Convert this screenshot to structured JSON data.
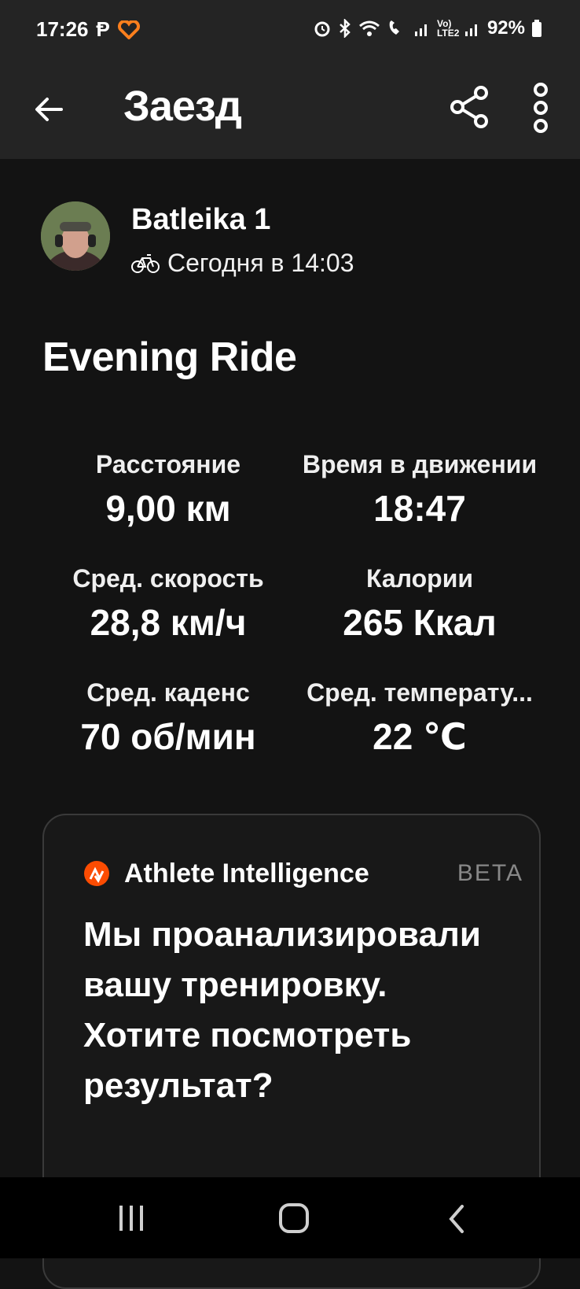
{
  "status_bar": {
    "time": "17:26",
    "battery": "92%",
    "icons": [
      "p-app-icon",
      "strava-heart-icon",
      "alarm-icon",
      "bluetooth-icon",
      "wifi-icon",
      "wifi-call-icon",
      "signal-icon",
      "volte-icon",
      "signal-icon-2",
      "battery-icon"
    ]
  },
  "app_bar": {
    "title": "Заезд",
    "icons": [
      "back-arrow-icon",
      "share-icon",
      "more-vertical-icon"
    ]
  },
  "athlete": {
    "name": "Batleika 1",
    "meta": "Сегодня в 14:03",
    "activity_icon": "bike-icon"
  },
  "activity": {
    "title": "Evening Ride"
  },
  "stats": [
    {
      "label": "Расстояние",
      "value": "9,00 км"
    },
    {
      "label": "Время в движении",
      "value": "18:47"
    },
    {
      "label": "Сред. скорость",
      "value": "28,8 км/ч"
    },
    {
      "label": "Калории",
      "value": "265 Ккал"
    },
    {
      "label": "Сред. каденс",
      "value": "70 об/мин"
    },
    {
      "label": "Сред. температу...",
      "value": "22 ℃"
    }
  ],
  "ai_card": {
    "title": "Athlete Intelligence",
    "badge": "BETA",
    "message": "Мы проанализировали вашу тренировку. Хотите посмотреть результат?",
    "accent": "#FC4C02"
  },
  "nav_bar": {
    "icons": [
      "recent-apps-icon",
      "home-icon",
      "back-icon"
    ]
  }
}
